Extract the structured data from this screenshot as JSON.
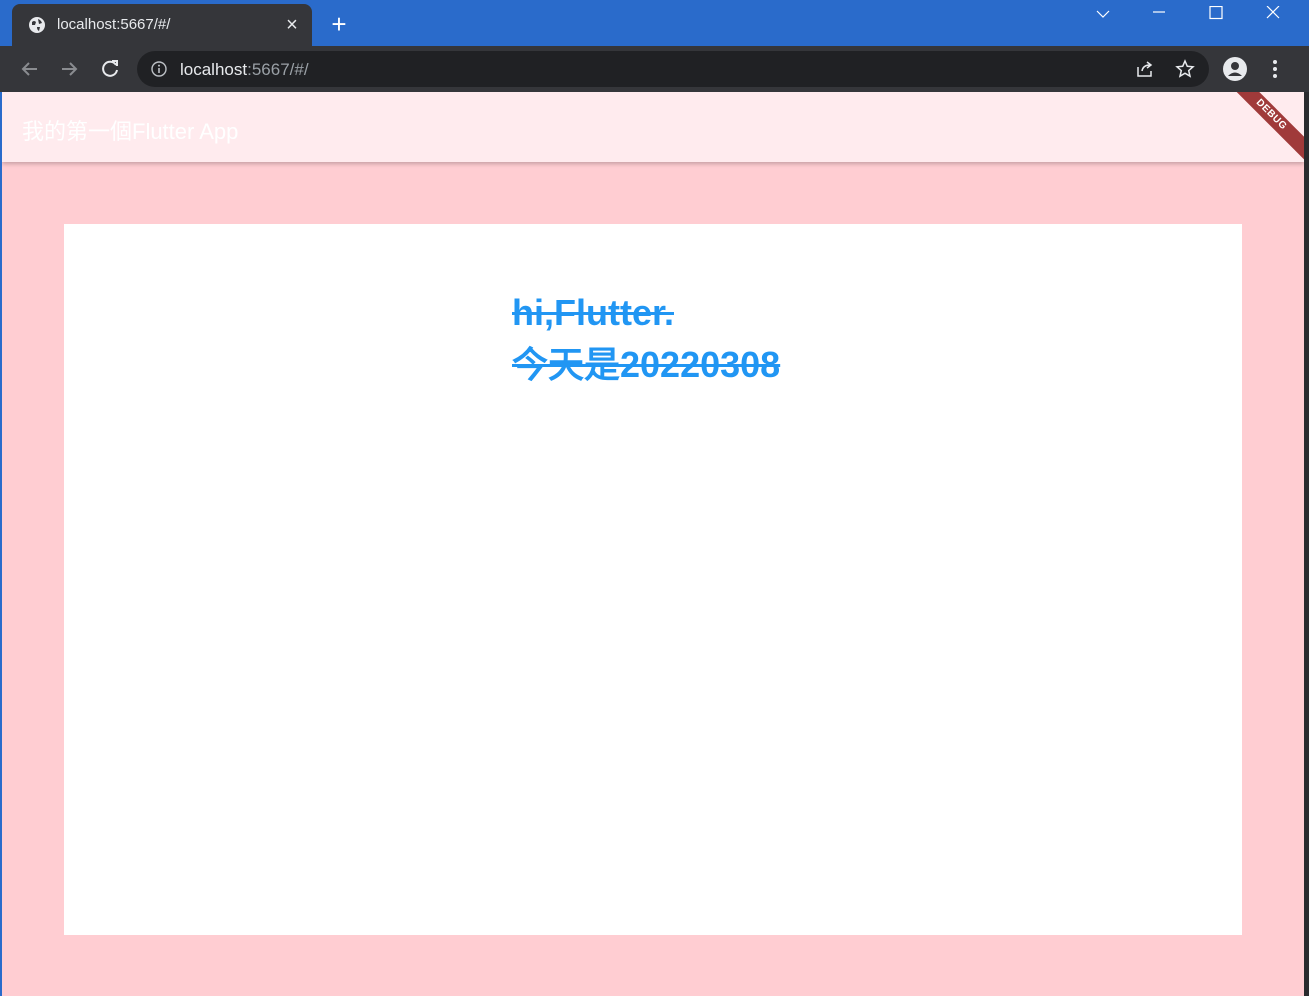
{
  "browser": {
    "tab": {
      "title": "localhost:5667/#/",
      "favicon": "globe-icon"
    },
    "url": {
      "host": "localhost",
      "rest": ":5667/#/"
    },
    "colors": {
      "frame": "#2a6bcb",
      "tab": "#35363a",
      "omnibox": "#202124"
    }
  },
  "app": {
    "appbar_title": "我的第一個Flutter App",
    "debug_banner": "DEBUG",
    "colors": {
      "background": "#ffcdd2",
      "appbar": "#ffebee",
      "card": "#ffffff",
      "text": "#2196f3"
    }
  },
  "content": {
    "line1": "hi,Flutter.",
    "line2": "今天是20220308"
  }
}
